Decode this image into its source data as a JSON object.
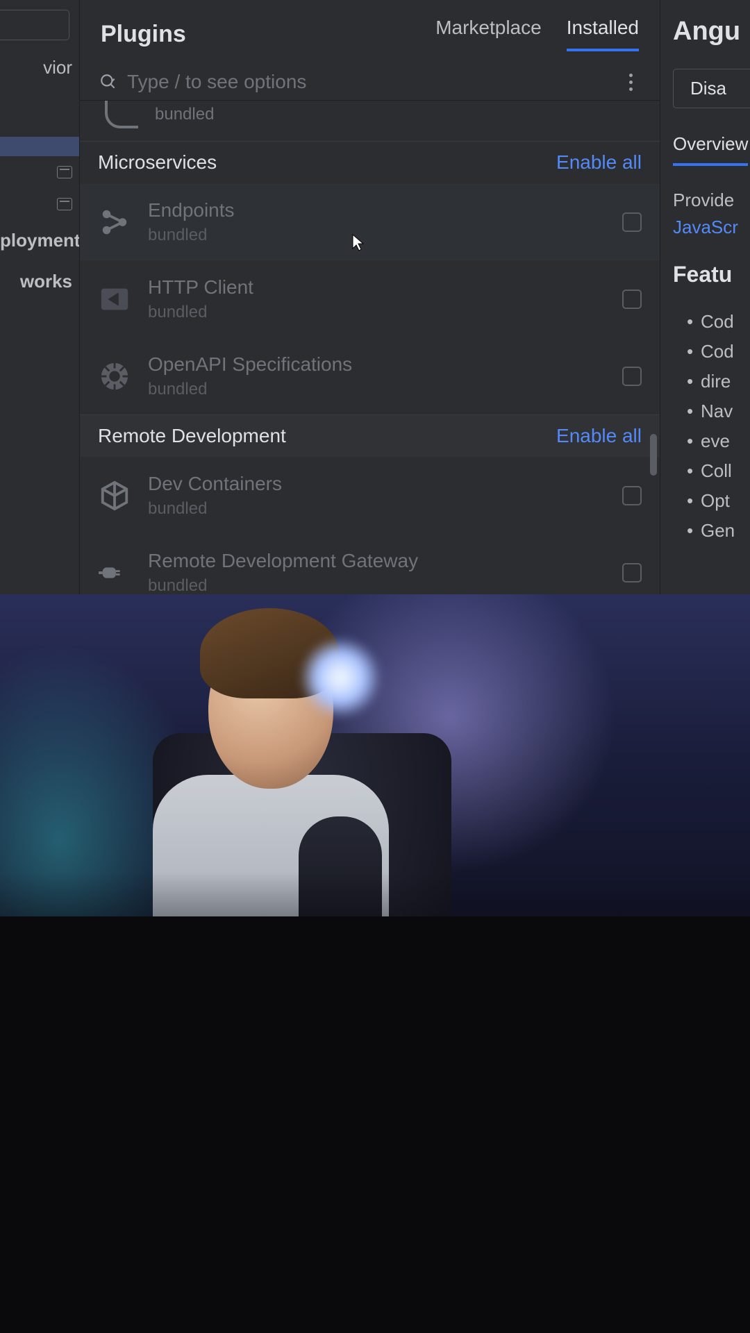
{
  "sidebar": {
    "items": [
      "vior",
      "",
      "ployment",
      "works"
    ]
  },
  "header": {
    "title": "Plugins",
    "tabs": {
      "marketplace": "Marketplace",
      "installed": "Installed"
    }
  },
  "search": {
    "placeholder": "Type / to see options"
  },
  "partial_plugin": {
    "sub": "bundled"
  },
  "groups": [
    {
      "title": "Microservices",
      "enable_all": "Enable all",
      "plugins": [
        {
          "name": "Endpoints",
          "sub": "bundled",
          "icon": "endpoints"
        },
        {
          "name": "HTTP Client",
          "sub": "bundled",
          "icon": "http"
        },
        {
          "name": "OpenAPI Specifications",
          "sub": "bundled",
          "icon": "openapi"
        }
      ]
    },
    {
      "title": "Remote Development",
      "enable_all": "Enable all",
      "plugins": [
        {
          "name": "Dev Containers",
          "sub": "bundled",
          "icon": "cube"
        },
        {
          "name": "Remote Development Gateway",
          "sub": "bundled",
          "icon": "plug"
        }
      ]
    }
  ],
  "right_panel": {
    "title": "Angu",
    "disable_btn": "Disa",
    "tab_overview": "Overview",
    "provides": "Provide",
    "js_link": "JavaScr",
    "features_heading": "Featu",
    "bullets": [
      "Cod",
      "Cod",
      "dire",
      "Nav",
      "eve",
      "Coll",
      "Opt",
      "Gen"
    ]
  }
}
